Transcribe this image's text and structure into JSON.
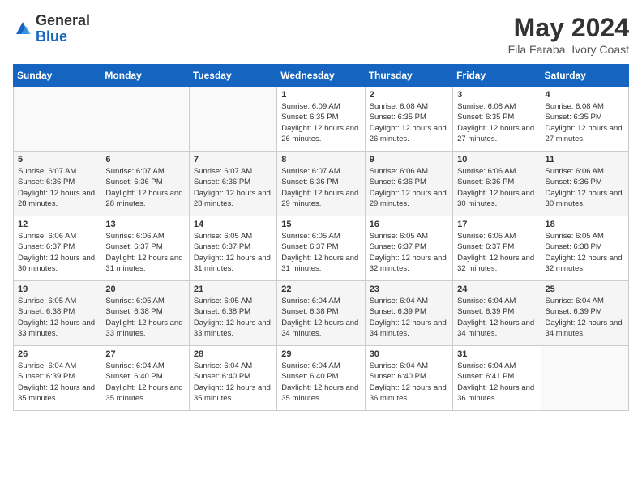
{
  "header": {
    "logo_general": "General",
    "logo_blue": "Blue",
    "title": "May 2024",
    "location": "Fila Faraba, Ivory Coast"
  },
  "weekdays": [
    "Sunday",
    "Monday",
    "Tuesday",
    "Wednesday",
    "Thursday",
    "Friday",
    "Saturday"
  ],
  "weeks": [
    [
      {
        "day": "",
        "info": ""
      },
      {
        "day": "",
        "info": ""
      },
      {
        "day": "",
        "info": ""
      },
      {
        "day": "1",
        "info": "Sunrise: 6:09 AM\nSunset: 6:35 PM\nDaylight: 12 hours and 26 minutes."
      },
      {
        "day": "2",
        "info": "Sunrise: 6:08 AM\nSunset: 6:35 PM\nDaylight: 12 hours and 26 minutes."
      },
      {
        "day": "3",
        "info": "Sunrise: 6:08 AM\nSunset: 6:35 PM\nDaylight: 12 hours and 27 minutes."
      },
      {
        "day": "4",
        "info": "Sunrise: 6:08 AM\nSunset: 6:35 PM\nDaylight: 12 hours and 27 minutes."
      }
    ],
    [
      {
        "day": "5",
        "info": "Sunrise: 6:07 AM\nSunset: 6:36 PM\nDaylight: 12 hours and 28 minutes."
      },
      {
        "day": "6",
        "info": "Sunrise: 6:07 AM\nSunset: 6:36 PM\nDaylight: 12 hours and 28 minutes."
      },
      {
        "day": "7",
        "info": "Sunrise: 6:07 AM\nSunset: 6:36 PM\nDaylight: 12 hours and 28 minutes."
      },
      {
        "day": "8",
        "info": "Sunrise: 6:07 AM\nSunset: 6:36 PM\nDaylight: 12 hours and 29 minutes."
      },
      {
        "day": "9",
        "info": "Sunrise: 6:06 AM\nSunset: 6:36 PM\nDaylight: 12 hours and 29 minutes."
      },
      {
        "day": "10",
        "info": "Sunrise: 6:06 AM\nSunset: 6:36 PM\nDaylight: 12 hours and 30 minutes."
      },
      {
        "day": "11",
        "info": "Sunrise: 6:06 AM\nSunset: 6:36 PM\nDaylight: 12 hours and 30 minutes."
      }
    ],
    [
      {
        "day": "12",
        "info": "Sunrise: 6:06 AM\nSunset: 6:37 PM\nDaylight: 12 hours and 30 minutes."
      },
      {
        "day": "13",
        "info": "Sunrise: 6:06 AM\nSunset: 6:37 PM\nDaylight: 12 hours and 31 minutes."
      },
      {
        "day": "14",
        "info": "Sunrise: 6:05 AM\nSunset: 6:37 PM\nDaylight: 12 hours and 31 minutes."
      },
      {
        "day": "15",
        "info": "Sunrise: 6:05 AM\nSunset: 6:37 PM\nDaylight: 12 hours and 31 minutes."
      },
      {
        "day": "16",
        "info": "Sunrise: 6:05 AM\nSunset: 6:37 PM\nDaylight: 12 hours and 32 minutes."
      },
      {
        "day": "17",
        "info": "Sunrise: 6:05 AM\nSunset: 6:37 PM\nDaylight: 12 hours and 32 minutes."
      },
      {
        "day": "18",
        "info": "Sunrise: 6:05 AM\nSunset: 6:38 PM\nDaylight: 12 hours and 32 minutes."
      }
    ],
    [
      {
        "day": "19",
        "info": "Sunrise: 6:05 AM\nSunset: 6:38 PM\nDaylight: 12 hours and 33 minutes."
      },
      {
        "day": "20",
        "info": "Sunrise: 6:05 AM\nSunset: 6:38 PM\nDaylight: 12 hours and 33 minutes."
      },
      {
        "day": "21",
        "info": "Sunrise: 6:05 AM\nSunset: 6:38 PM\nDaylight: 12 hours and 33 minutes."
      },
      {
        "day": "22",
        "info": "Sunrise: 6:04 AM\nSunset: 6:38 PM\nDaylight: 12 hours and 34 minutes."
      },
      {
        "day": "23",
        "info": "Sunrise: 6:04 AM\nSunset: 6:39 PM\nDaylight: 12 hours and 34 minutes."
      },
      {
        "day": "24",
        "info": "Sunrise: 6:04 AM\nSunset: 6:39 PM\nDaylight: 12 hours and 34 minutes."
      },
      {
        "day": "25",
        "info": "Sunrise: 6:04 AM\nSunset: 6:39 PM\nDaylight: 12 hours and 34 minutes."
      }
    ],
    [
      {
        "day": "26",
        "info": "Sunrise: 6:04 AM\nSunset: 6:39 PM\nDaylight: 12 hours and 35 minutes."
      },
      {
        "day": "27",
        "info": "Sunrise: 6:04 AM\nSunset: 6:40 PM\nDaylight: 12 hours and 35 minutes."
      },
      {
        "day": "28",
        "info": "Sunrise: 6:04 AM\nSunset: 6:40 PM\nDaylight: 12 hours and 35 minutes."
      },
      {
        "day": "29",
        "info": "Sunrise: 6:04 AM\nSunset: 6:40 PM\nDaylight: 12 hours and 35 minutes."
      },
      {
        "day": "30",
        "info": "Sunrise: 6:04 AM\nSunset: 6:40 PM\nDaylight: 12 hours and 36 minutes."
      },
      {
        "day": "31",
        "info": "Sunrise: 6:04 AM\nSunset: 6:41 PM\nDaylight: 12 hours and 36 minutes."
      },
      {
        "day": "",
        "info": ""
      }
    ]
  ]
}
